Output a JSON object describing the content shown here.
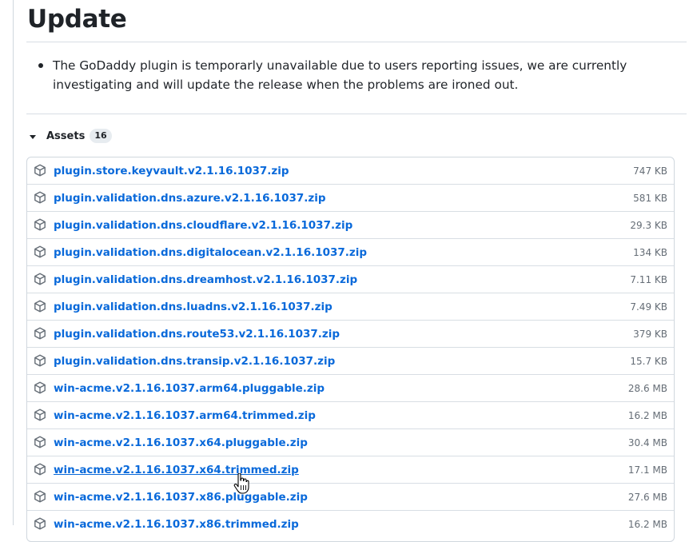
{
  "release": {
    "heading": "Update",
    "notes": [
      "The GoDaddy plugin is temporarly unavailable due to users reporting issues, we are currently investigating and will update the release when the problems are ironed out."
    ]
  },
  "assets": {
    "label": "Assets",
    "count": "16",
    "items": [
      {
        "name": "plugin.store.keyvault.v2.1.16.1037.zip",
        "size": "747 KB",
        "icon": "package-icon"
      },
      {
        "name": "plugin.validation.dns.azure.v2.1.16.1037.zip",
        "size": "581 KB",
        "icon": "package-icon"
      },
      {
        "name": "plugin.validation.dns.cloudflare.v2.1.16.1037.zip",
        "size": "29.3 KB",
        "icon": "package-icon"
      },
      {
        "name": "plugin.validation.dns.digitalocean.v2.1.16.1037.zip",
        "size": "134 KB",
        "icon": "package-icon"
      },
      {
        "name": "plugin.validation.dns.dreamhost.v2.1.16.1037.zip",
        "size": "7.11 KB",
        "icon": "package-icon"
      },
      {
        "name": "plugin.validation.dns.luadns.v2.1.16.1037.zip",
        "size": "7.49 KB",
        "icon": "package-icon"
      },
      {
        "name": "plugin.validation.dns.route53.v2.1.16.1037.zip",
        "size": "379 KB",
        "icon": "package-icon"
      },
      {
        "name": "plugin.validation.dns.transip.v2.1.16.1037.zip",
        "size": "15.7 KB",
        "icon": "package-icon"
      },
      {
        "name": "win-acme.v2.1.16.1037.arm64.pluggable.zip",
        "size": "28.6 MB",
        "icon": "package-icon"
      },
      {
        "name": "win-acme.v2.1.16.1037.arm64.trimmed.zip",
        "size": "16.2 MB",
        "icon": "package-icon"
      },
      {
        "name": "win-acme.v2.1.16.1037.x64.pluggable.zip",
        "size": "30.4 MB",
        "icon": "package-icon"
      },
      {
        "name": "win-acme.v2.1.16.1037.x64.trimmed.zip",
        "size": "17.1 MB",
        "icon": "package-icon",
        "hovered": true
      },
      {
        "name": "win-acme.v2.1.16.1037.x86.pluggable.zip",
        "size": "27.6 MB",
        "icon": "package-icon"
      },
      {
        "name": "win-acme.v2.1.16.1037.x86.trimmed.zip",
        "size": "16.2 MB",
        "icon": "package-icon"
      }
    ]
  },
  "colors": {
    "link": "#0969da",
    "muted": "#656d76",
    "border": "#d0d7de"
  },
  "cursor": {
    "icon": "hand-pointer-icon"
  }
}
